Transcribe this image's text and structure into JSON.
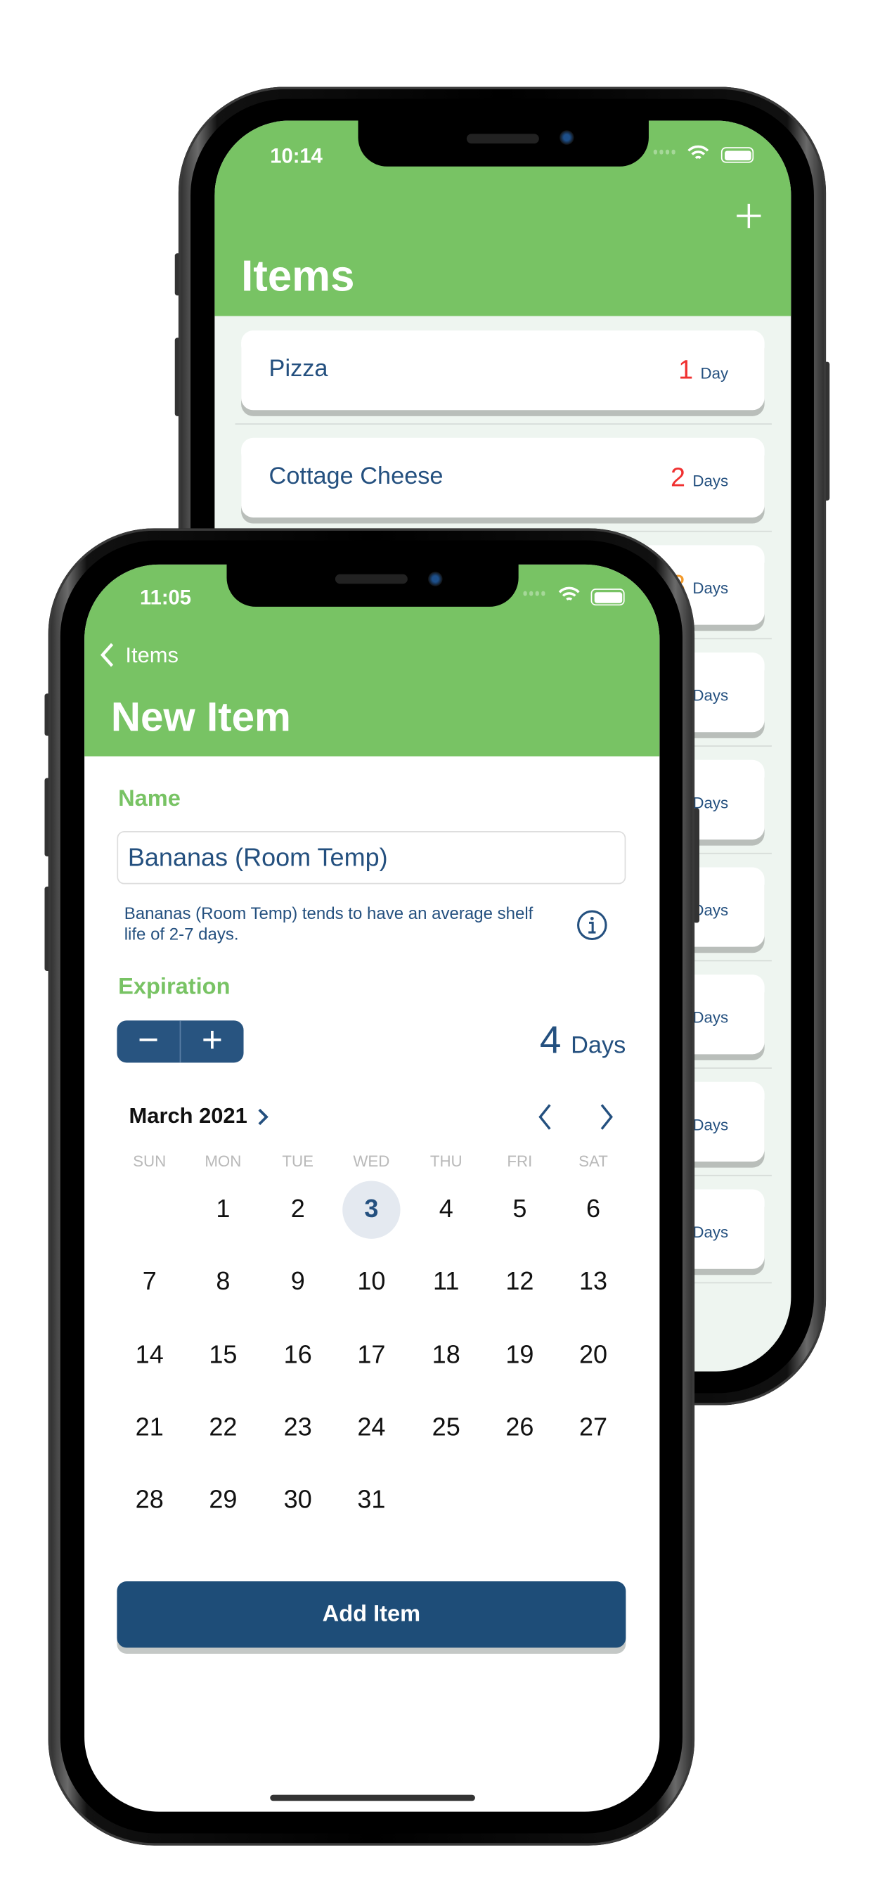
{
  "back_phone": {
    "status_time": "10:14",
    "add_icon": "plus-icon",
    "title": "Items",
    "items": [
      {
        "name": "Pizza",
        "count": "1",
        "unit": "Day",
        "color": "#F03030"
      },
      {
        "name": "Cottage Cheese",
        "count": "2",
        "unit": "Days",
        "color": "#F03030"
      },
      {
        "name": "",
        "count": "3",
        "unit": "Days",
        "color": "#F39A2B"
      },
      {
        "name": "",
        "count": "",
        "unit": "Days",
        "color": "#24507F"
      },
      {
        "name": "",
        "count": "",
        "unit": "Days",
        "color": "#24507F"
      },
      {
        "name": "",
        "count": "",
        "unit": "Days",
        "color": "#24507F"
      },
      {
        "name": "",
        "count": "",
        "unit": "Days",
        "color": "#24507F"
      },
      {
        "name": "",
        "count": "",
        "unit": "Days",
        "color": "#24507F"
      },
      {
        "name": "",
        "count": "",
        "unit": "Days",
        "color": "#24507F"
      }
    ]
  },
  "front_phone": {
    "status_time": "11:05",
    "back_label": "Items",
    "title": "New Item",
    "name_label": "Name",
    "name_value": "Bananas (Room Temp)",
    "help_text": "Bananas (Room Temp) tends to have an average shelf life of 2-7 days.",
    "expiration_label": "Expiration",
    "stepper": {
      "minus": "−",
      "plus": "+"
    },
    "days_count": "4",
    "days_unit": "Days",
    "calendar": {
      "month_label": "March 2021",
      "weekdays": [
        "SUN",
        "MON",
        "TUE",
        "WED",
        "THU",
        "FRI",
        "SAT"
      ],
      "first_weekday_index": 1,
      "days_in_month": 31,
      "selected_day": 3
    },
    "add_button": "Add Item"
  },
  "colors": {
    "brand_green": "#78C364",
    "brand_blue": "#1E4D78",
    "text_blue": "#24507F",
    "list_bg": "#EEF5F0"
  }
}
